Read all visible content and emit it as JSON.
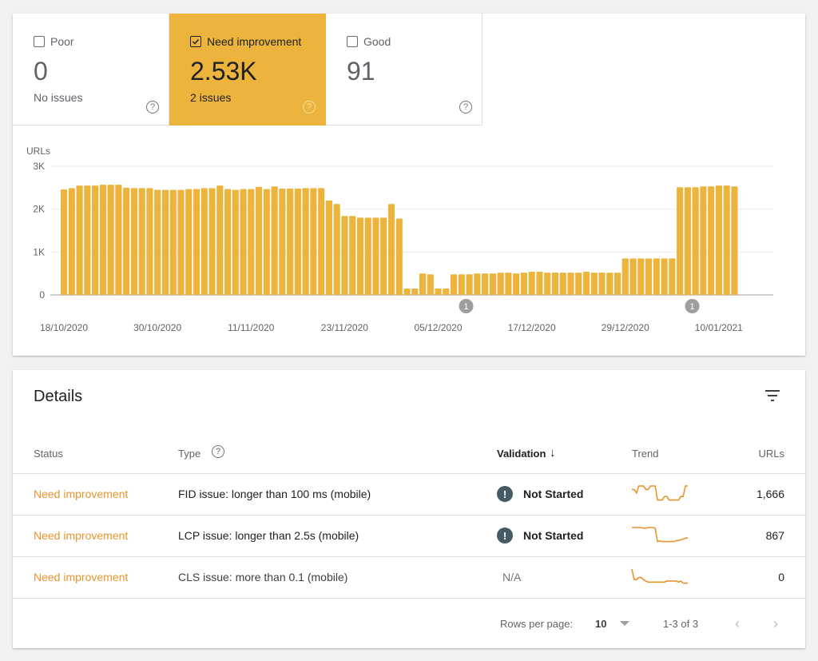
{
  "tiles": [
    {
      "label": "Poor",
      "checked": false,
      "value": "0",
      "sub": "No issues",
      "help": "?"
    },
    {
      "label": "Need improvement",
      "checked": true,
      "value": "2.53K",
      "sub": "2 issues",
      "help": "?"
    },
    {
      "label": "Good",
      "checked": false,
      "value": "91",
      "sub": "",
      "help": "?"
    }
  ],
  "colors": {
    "accent": "#ecb43d",
    "status_text": "#e8942b",
    "trend_line": "#e8942b",
    "annotation": "#9e9e9e"
  },
  "chart_data": {
    "type": "bar",
    "ylabel": "URLs",
    "ylim": [
      0,
      3000
    ],
    "yticks": [
      "0",
      "1K",
      "2K",
      "3K"
    ],
    "xtick_labels": [
      "18/10/2020",
      "30/10/2020",
      "11/11/2020",
      "23/11/2020",
      "05/12/2020",
      "17/12/2020",
      "29/12/2020",
      "10/01/2021"
    ],
    "annotations": [
      {
        "label": "1",
        "near": "05/12/2020"
      },
      {
        "label": "1",
        "near": "10/01/2021"
      }
    ],
    "grid": true,
    "values": [
      2460,
      2490,
      2550,
      2550,
      2550,
      2570,
      2570,
      2570,
      2500,
      2490,
      2490,
      2490,
      2450,
      2450,
      2450,
      2450,
      2470,
      2470,
      2490,
      2490,
      2550,
      2470,
      2450,
      2470,
      2470,
      2520,
      2470,
      2530,
      2480,
      2480,
      2480,
      2490,
      2490,
      2490,
      2200,
      2120,
      1840,
      1840,
      1800,
      1800,
      1800,
      1800,
      2120,
      1780,
      150,
      150,
      500,
      480,
      150,
      150,
      480,
      480,
      480,
      500,
      500,
      500,
      520,
      520,
      500,
      520,
      540,
      540,
      520,
      520,
      520,
      520,
      520,
      540,
      520,
      520,
      520,
      520,
      850,
      850,
      850,
      850,
      850,
      850,
      850,
      2510,
      2510,
      2510,
      2530,
      2530,
      2550,
      2550,
      2530
    ]
  },
  "details": {
    "title": "Details",
    "filter_icon": "filter-icon",
    "columns": {
      "status": "Status",
      "type": "Type",
      "validation": "Validation",
      "trend": "Trend",
      "urls": "URLs"
    },
    "rows": [
      {
        "status": "Need improvement",
        "type": "FID issue: longer than 100 ms (mobile)",
        "validation": "Not Started",
        "validation_icon": true,
        "urls": "1,666",
        "trend": [
          4,
          4,
          3,
          5,
          5,
          5,
          4,
          4,
          5,
          5,
          5,
          1,
          1,
          1,
          2,
          2,
          1,
          1,
          1,
          1,
          1,
          2,
          2,
          5,
          5
        ]
      },
      {
        "status": "Need improvement",
        "type": "LCP issue: longer than 2.5s (mobile)",
        "validation": "Not Started",
        "validation_icon": true,
        "urls": "867",
        "trend": [
          5,
          5,
          5,
          5,
          5,
          4.8,
          4.8,
          5,
          5,
          5,
          4.8,
          1,
          1.2,
          1,
          1,
          1,
          1,
          1,
          1,
          1.3,
          1.3,
          1.5,
          1.7,
          2,
          2
        ]
      },
      {
        "status": "Need improvement",
        "type": "CLS issue: more than 0.1 (mobile)",
        "validation": "N/A",
        "validation_icon": false,
        "urls": "0",
        "trend": [
          5,
          2,
          2,
          2.6,
          2.6,
          2,
          1.6,
          1.3,
          1.3,
          1.3,
          1.3,
          1.3,
          1.3,
          1.3,
          1.3,
          1.6,
          1.6,
          1.6,
          1.6,
          1.6,
          1.3,
          1.6,
          1,
          1,
          1
        ]
      }
    ],
    "pager": {
      "rows_label": "Rows per page:",
      "rows_value": "10",
      "range": "1-3 of 3"
    }
  }
}
